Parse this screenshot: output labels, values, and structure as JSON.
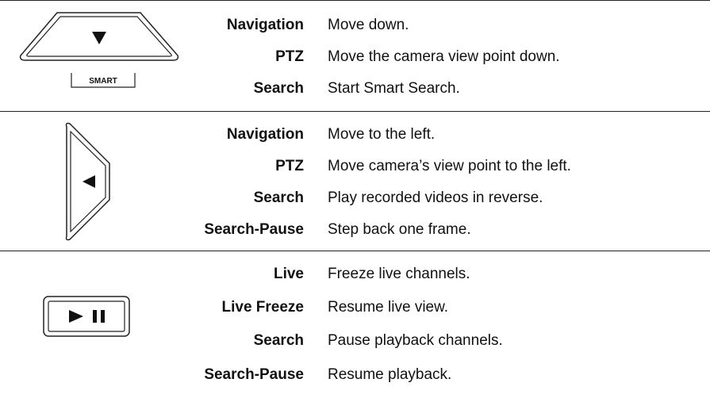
{
  "sections": [
    {
      "button": {
        "icon": "down-arrow-smart-button-icon",
        "sublabel": "SMART"
      },
      "rows": [
        {
          "mode": "Navigation",
          "desc": "Move down."
        },
        {
          "mode": "PTZ",
          "desc": "Move the camera view point down."
        },
        {
          "mode": "Search",
          "desc": "Start Smart Search."
        }
      ]
    },
    {
      "button": {
        "icon": "left-arrow-button-icon"
      },
      "rows": [
        {
          "mode": "Navigation",
          "desc": "Move to the left."
        },
        {
          "mode": "PTZ",
          "desc": "Move camera’s view point to the left."
        },
        {
          "mode": "Search",
          "desc": "Play recorded videos in reverse."
        },
        {
          "mode": "Search-Pause",
          "desc": "Step back one frame."
        }
      ]
    },
    {
      "button": {
        "icon": "play-pause-button-icon"
      },
      "rows": [
        {
          "mode": "Live",
          "desc": "Freeze live channels."
        },
        {
          "mode": "Live Freeze",
          "desc": "Resume live view."
        },
        {
          "mode": "Search",
          "desc": "Pause playback channels."
        },
        {
          "mode": "Search-Pause",
          "desc": "Resume playback."
        }
      ]
    }
  ]
}
